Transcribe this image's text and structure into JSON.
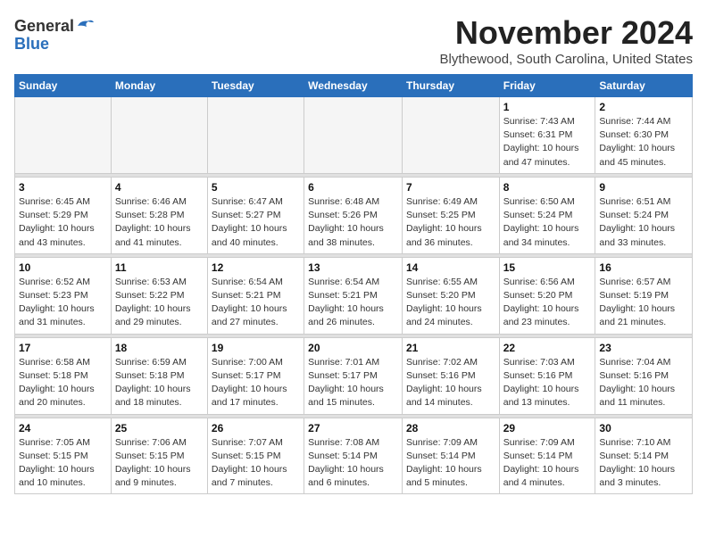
{
  "logo": {
    "general": "General",
    "blue": "Blue"
  },
  "title": "November 2024",
  "location": "Blythewood, South Carolina, United States",
  "weekdays": [
    "Sunday",
    "Monday",
    "Tuesday",
    "Wednesday",
    "Thursday",
    "Friday",
    "Saturday"
  ],
  "weeks": [
    [
      {
        "day": "",
        "info": ""
      },
      {
        "day": "",
        "info": ""
      },
      {
        "day": "",
        "info": ""
      },
      {
        "day": "",
        "info": ""
      },
      {
        "day": "",
        "info": ""
      },
      {
        "day": "1",
        "info": "Sunrise: 7:43 AM\nSunset: 6:31 PM\nDaylight: 10 hours and 47 minutes."
      },
      {
        "day": "2",
        "info": "Sunrise: 7:44 AM\nSunset: 6:30 PM\nDaylight: 10 hours and 45 minutes."
      }
    ],
    [
      {
        "day": "3",
        "info": "Sunrise: 6:45 AM\nSunset: 5:29 PM\nDaylight: 10 hours and 43 minutes."
      },
      {
        "day": "4",
        "info": "Sunrise: 6:46 AM\nSunset: 5:28 PM\nDaylight: 10 hours and 41 minutes."
      },
      {
        "day": "5",
        "info": "Sunrise: 6:47 AM\nSunset: 5:27 PM\nDaylight: 10 hours and 40 minutes."
      },
      {
        "day": "6",
        "info": "Sunrise: 6:48 AM\nSunset: 5:26 PM\nDaylight: 10 hours and 38 minutes."
      },
      {
        "day": "7",
        "info": "Sunrise: 6:49 AM\nSunset: 5:25 PM\nDaylight: 10 hours and 36 minutes."
      },
      {
        "day": "8",
        "info": "Sunrise: 6:50 AM\nSunset: 5:24 PM\nDaylight: 10 hours and 34 minutes."
      },
      {
        "day": "9",
        "info": "Sunrise: 6:51 AM\nSunset: 5:24 PM\nDaylight: 10 hours and 33 minutes."
      }
    ],
    [
      {
        "day": "10",
        "info": "Sunrise: 6:52 AM\nSunset: 5:23 PM\nDaylight: 10 hours and 31 minutes."
      },
      {
        "day": "11",
        "info": "Sunrise: 6:53 AM\nSunset: 5:22 PM\nDaylight: 10 hours and 29 minutes."
      },
      {
        "day": "12",
        "info": "Sunrise: 6:54 AM\nSunset: 5:21 PM\nDaylight: 10 hours and 27 minutes."
      },
      {
        "day": "13",
        "info": "Sunrise: 6:54 AM\nSunset: 5:21 PM\nDaylight: 10 hours and 26 minutes."
      },
      {
        "day": "14",
        "info": "Sunrise: 6:55 AM\nSunset: 5:20 PM\nDaylight: 10 hours and 24 minutes."
      },
      {
        "day": "15",
        "info": "Sunrise: 6:56 AM\nSunset: 5:20 PM\nDaylight: 10 hours and 23 minutes."
      },
      {
        "day": "16",
        "info": "Sunrise: 6:57 AM\nSunset: 5:19 PM\nDaylight: 10 hours and 21 minutes."
      }
    ],
    [
      {
        "day": "17",
        "info": "Sunrise: 6:58 AM\nSunset: 5:18 PM\nDaylight: 10 hours and 20 minutes."
      },
      {
        "day": "18",
        "info": "Sunrise: 6:59 AM\nSunset: 5:18 PM\nDaylight: 10 hours and 18 minutes."
      },
      {
        "day": "19",
        "info": "Sunrise: 7:00 AM\nSunset: 5:17 PM\nDaylight: 10 hours and 17 minutes."
      },
      {
        "day": "20",
        "info": "Sunrise: 7:01 AM\nSunset: 5:17 PM\nDaylight: 10 hours and 15 minutes."
      },
      {
        "day": "21",
        "info": "Sunrise: 7:02 AM\nSunset: 5:16 PM\nDaylight: 10 hours and 14 minutes."
      },
      {
        "day": "22",
        "info": "Sunrise: 7:03 AM\nSunset: 5:16 PM\nDaylight: 10 hours and 13 minutes."
      },
      {
        "day": "23",
        "info": "Sunrise: 7:04 AM\nSunset: 5:16 PM\nDaylight: 10 hours and 11 minutes."
      }
    ],
    [
      {
        "day": "24",
        "info": "Sunrise: 7:05 AM\nSunset: 5:15 PM\nDaylight: 10 hours and 10 minutes."
      },
      {
        "day": "25",
        "info": "Sunrise: 7:06 AM\nSunset: 5:15 PM\nDaylight: 10 hours and 9 minutes."
      },
      {
        "day": "26",
        "info": "Sunrise: 7:07 AM\nSunset: 5:15 PM\nDaylight: 10 hours and 7 minutes."
      },
      {
        "day": "27",
        "info": "Sunrise: 7:08 AM\nSunset: 5:14 PM\nDaylight: 10 hours and 6 minutes."
      },
      {
        "day": "28",
        "info": "Sunrise: 7:09 AM\nSunset: 5:14 PM\nDaylight: 10 hours and 5 minutes."
      },
      {
        "day": "29",
        "info": "Sunrise: 7:09 AM\nSunset: 5:14 PM\nDaylight: 10 hours and 4 minutes."
      },
      {
        "day": "30",
        "info": "Sunrise: 7:10 AM\nSunset: 5:14 PM\nDaylight: 10 hours and 3 minutes."
      }
    ]
  ]
}
